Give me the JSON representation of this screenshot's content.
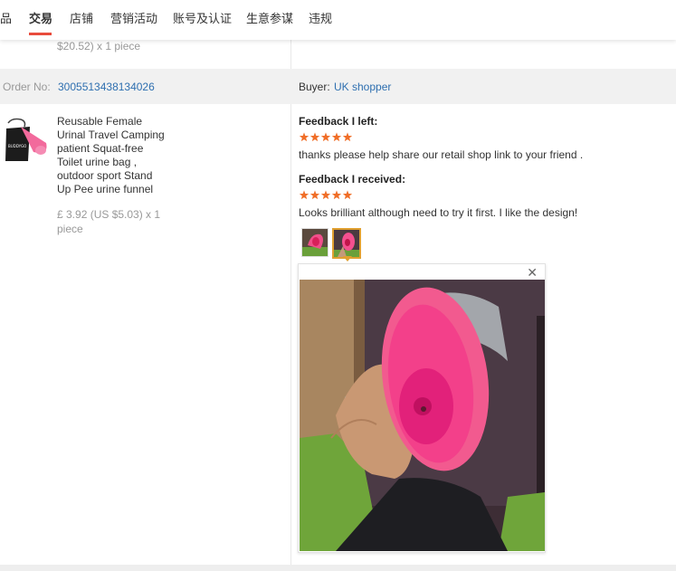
{
  "nav": {
    "tabs": [
      {
        "label": "品"
      },
      {
        "label": "交易"
      },
      {
        "label": "店铺"
      },
      {
        "label": "营销活动"
      },
      {
        "label": "账号及认证"
      },
      {
        "label": "生意参谋"
      },
      {
        "label": "违规"
      }
    ],
    "active_tab": "交易",
    "accent_color": "#e94b3c"
  },
  "previous_item": {
    "price_text": "$20.52) x 1 piece"
  },
  "order": {
    "order_no_label": "Order No:",
    "order_no": "3005513438134026",
    "buyer_label": "Buyer:",
    "buyer": "UK shopper",
    "link_color": "#2e6fb0"
  },
  "product": {
    "title_lines": [
      "Reusable Female",
      "Urinal Travel Camping",
      "patient Squat-free",
      "Toilet urine bag ,",
      "outdoor sport Stand",
      "Up Pee urine funnel"
    ],
    "price_lines": [
      "£ 3.92 (US $5.03) x 1",
      "piece"
    ],
    "thumb_text": "BUDDYGO"
  },
  "feedback": {
    "left_heading": "Feedback I left:",
    "left_rating": 5,
    "left_text": "thanks please help share our retail shop link to your friend .",
    "received_heading": "Feedback I received:",
    "received_rating": 5,
    "received_text": "Looks brilliant although need to try it first. I like the design!",
    "photo_count": 2,
    "selected_photo": 2,
    "star_color": "#f06e28"
  },
  "preview": {
    "close_icon": "close-icon"
  }
}
